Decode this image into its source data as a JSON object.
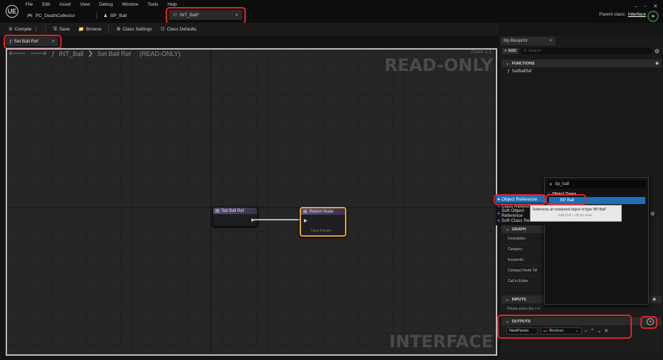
{
  "app": {
    "logo": "UE"
  },
  "menu": [
    "File",
    "Edit",
    "Asset",
    "View",
    "Debug",
    "Window",
    "Tools",
    "Help"
  ],
  "doc_tabs": [
    {
      "label": "PC_DeathCollector",
      "icon": "gamepad-icon"
    },
    {
      "label": "BP_Ball",
      "icon": "person-icon"
    },
    {
      "label": "INT_Ball*",
      "icon": "interface-icon",
      "close": "×"
    }
  ],
  "parent_class": {
    "label": "Parent class:",
    "value": "Interface"
  },
  "toolbar": {
    "compile": "Compile",
    "save": "Save",
    "browse": "Browse",
    "class_settings": "Class Settings",
    "class_defaults": "Class Defaults"
  },
  "graph_tab": {
    "label": "Set Ball Ref",
    "close": "×"
  },
  "graph": {
    "breadcrumb_root": "INT_Ball",
    "breadcrumb_sep": "❯",
    "breadcrumb_leaf": "Set Ball Ref",
    "readonly_note": "(READ-ONLY)",
    "zoom": "Zoom 1:1",
    "watermark_top": "READ-ONLY",
    "watermark_bottom": "INTERFACE"
  },
  "nodes": {
    "entry": "Set Ball Ref",
    "return": "Return Node",
    "return_pin": "New Param"
  },
  "my_blueprint": {
    "tab": "My Blueprint",
    "close": "×",
    "add": "ADD",
    "search_placeholder": "Search",
    "functions": "FUNCTIONS",
    "function_item": "SetBallRef"
  },
  "details": {
    "graph_cat": "GRAPH",
    "rows": [
      "Description",
      "Category",
      "Keywords",
      "Compact Node Titl",
      "Call In Editor"
    ],
    "inputs": "INPUTS",
    "inputs_hint": "Please press the + ic",
    "outputs": "OUTPUTS",
    "param_name": "NewParam",
    "param_type": "Boolean"
  },
  "type_dropdown": {
    "search_value": "bp_ball",
    "category": "Object Types",
    "item": "BP Ball"
  },
  "tooltip": {
    "line1": "Reference an instanced object of type 'BP Ball'",
    "line2": "hold (Ctrl + Alt) for more"
  },
  "submenu": [
    "Object Reference",
    "Class Reference",
    "Soft Object Reference",
    "Soft Class Reference"
  ],
  "colors": {
    "highlight": "#e0242c",
    "selection": "#1d6fb8",
    "node_header": "#5b4b76"
  }
}
